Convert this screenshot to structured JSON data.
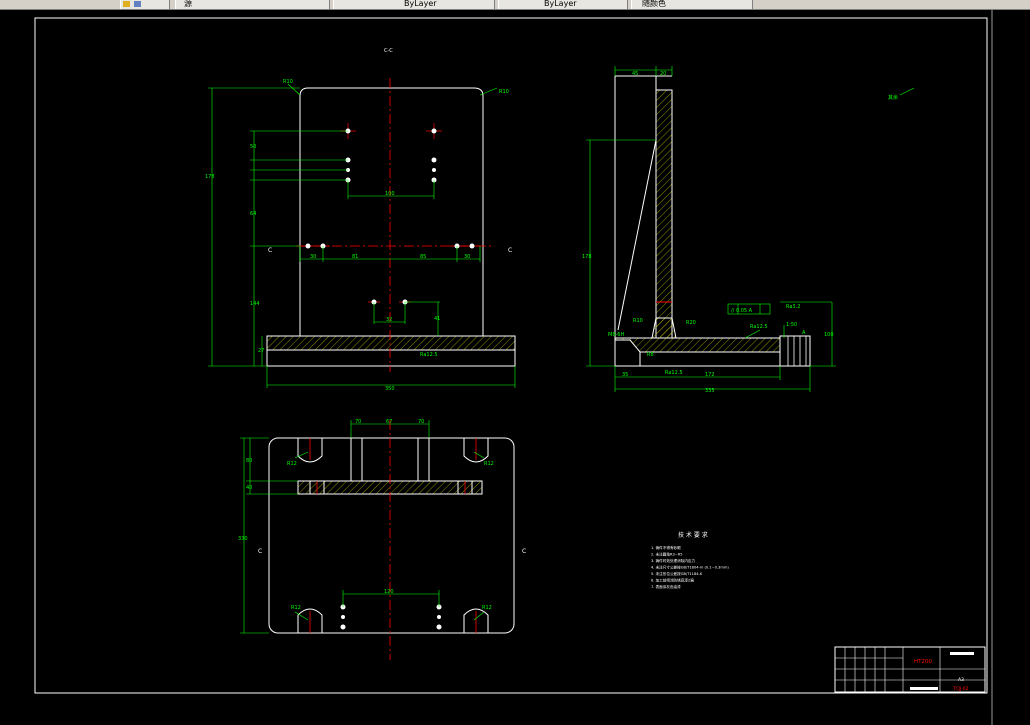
{
  "toolbar": {
    "segments": [
      "源",
      "ByLayer",
      "ByLayer",
      "随颜色"
    ]
  },
  "drawing": {
    "labels": {
      "view_marker": "C-C",
      "r10_left": "R10",
      "r10_right": "R10",
      "dim_178": "178",
      "dim_50": "50",
      "dim_64": "64",
      "dim_144": "144",
      "dim_27": "27",
      "dim_100": "100",
      "dim_30a": "30",
      "dim_81": "81",
      "dim_85": "85",
      "dim_30b": "30",
      "dim_32": "32",
      "dim_41": "41",
      "dim_350": "350",
      "section_c_left": "C",
      "section_c_right": "C",
      "roughness_1": "Ra12.5",
      "side_dim_45": "45",
      "side_dim_20": "20",
      "side_dim_178": "178",
      "side_dim_335": "335",
      "side_dim_172": "172",
      "side_dim_35": "35",
      "side_r10": "R10",
      "side_r20": "R20",
      "side_r8": "R8",
      "tolerance_box": "// 0.05 A",
      "roughness_2": "Ra12.5",
      "roughness_3": "Ra12.5",
      "roughness_4": "Ra3.2",
      "scale_note": "1:50",
      "datum_a": "A",
      "side_dim_100": "100",
      "side_m": "M8-6H",
      "overall_roughness": "其余",
      "plan_dim_70": "70",
      "plan_dim_67": "67",
      "plan_dim_70b": "70",
      "plan_r12a": "R12",
      "plan_r12b": "R12",
      "plan_r12c": "R12",
      "plan_r12d": "R12",
      "plan_dim_330": "330",
      "plan_dim_120": "120",
      "plan_dim_80": "80",
      "plan_dim_40": "40",
      "tech_title": "技 术 要 求",
      "title_part": "HT200",
      "title_sheet": "A3",
      "title_code": "TCJJ-02"
    },
    "tech_notes": [
      "1. 铸件不得有砂眼",
      "2. 未注圆角R3~R5",
      "3. 铸件时效处理消除内应力",
      "4. 未注尺寸公差按GB/T1804-m (0.1~0.3mm)",
      "5. 未注形位公差按GB/T1184-K",
      "6. 加工前喷涂防锈底漆2遍",
      "7. 表面涂灰色油漆"
    ],
    "colors": {
      "background": "#000000",
      "frame": "#ffffff",
      "dimension": "#00ff00",
      "centerline": "#ff0000",
      "hatch": "#cccc00",
      "part_outline": "#ffffff"
    }
  }
}
